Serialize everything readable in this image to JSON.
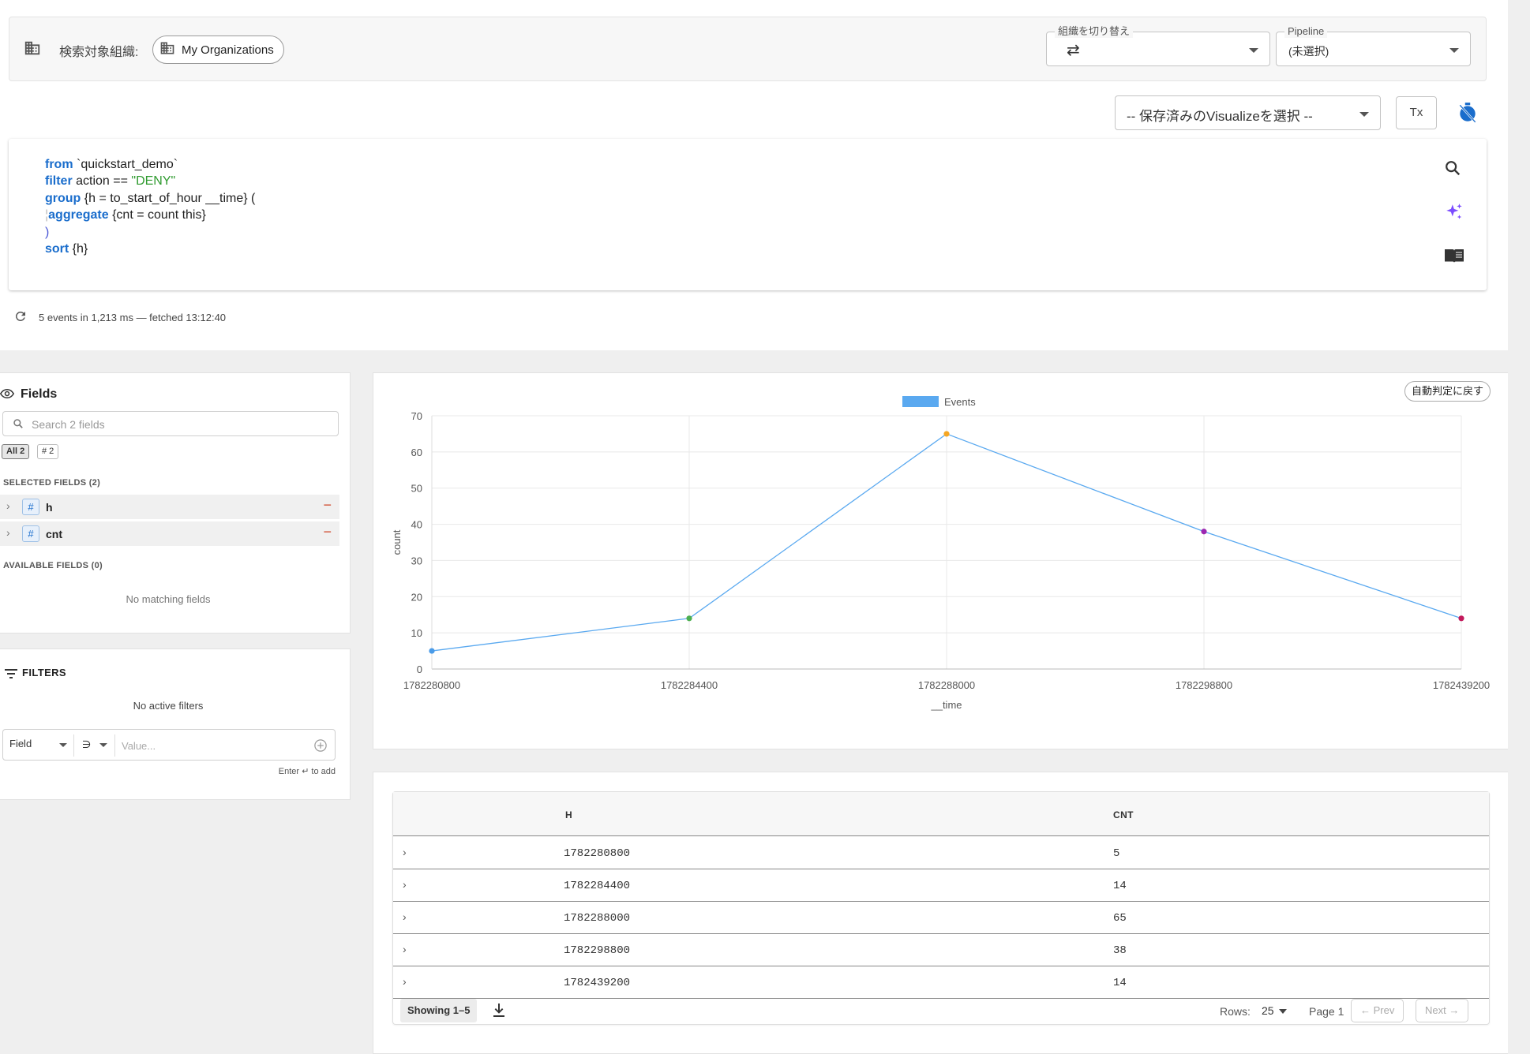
{
  "org_bar": {
    "search_org_label": "検索対象組織:",
    "org_chip": "My Organizations",
    "switch_org": {
      "label": "組織を切り替え"
    },
    "pipeline": {
      "label": "Pipeline",
      "value": "(未選択)"
    }
  },
  "toolbar": {
    "saved_visualize": "-- 保存済みのVisualizeを選択 --",
    "clear_format": "Tx"
  },
  "query": {
    "lines": [
      {
        "kw": "from",
        "rest": " `quickstart_demo`"
      },
      {
        "kw": "filter",
        "rest": " action == ",
        "str": "\"DENY\""
      },
      {
        "kw": "group",
        "rest": " {h = to_start_of_hour __time} ("
      },
      {
        "kw": "aggregate",
        "rest": " {cnt = count this}",
        "indent": true
      },
      {
        "kw": "",
        "rest": ")"
      },
      {
        "kw": "sort",
        "rest": " {h}"
      }
    ]
  },
  "status": {
    "text": "5 events in 1,213 ms — fetched 13:12:40"
  },
  "fields": {
    "title": "Fields",
    "search_placeholder": "Search 2 fields",
    "tabs": [
      "All 2",
      "# 2"
    ],
    "selected_label": "SELECTED FIELDS (2)",
    "selected": [
      {
        "type": "#",
        "name": "h"
      },
      {
        "type": "#",
        "name": "cnt"
      }
    ],
    "available_label": "AVAILABLE FIELDS (0)",
    "no_match": "No matching fields"
  },
  "filters": {
    "title": "FILTERS",
    "no_active": "No active filters",
    "field_select": "Field",
    "operator": "∋",
    "value_placeholder": "Value...",
    "hint": "Enter ↵ to add"
  },
  "chart": {
    "reset_button": "自動判定に戻す"
  },
  "chart_data": {
    "type": "line",
    "x": [
      1782280800,
      1782284400,
      1782288000,
      1782298800,
      1782439200
    ],
    "series": [
      {
        "name": "Events",
        "values": [
          5,
          14,
          65,
          38,
          14
        ]
      }
    ],
    "xlabel": "__time",
    "ylabel": "count",
    "ylim": [
      0,
      70
    ],
    "yticks": [
      0,
      10,
      20,
      30,
      40,
      50,
      60,
      70
    ],
    "legend": "top-center",
    "grid": true,
    "colors": {
      "line": "#5aa9f0",
      "legend": "#5aa9f0",
      "points": [
        "#4a9be8",
        "#4caf50",
        "#f5a623",
        "#9c27b0",
        "#c2185b"
      ]
    }
  },
  "table": {
    "columns": [
      "H",
      "CNT"
    ],
    "rows": [
      [
        "1782280800",
        "5"
      ],
      [
        "1782284400",
        "14"
      ],
      [
        "1782288000",
        "65"
      ],
      [
        "1782298800",
        "38"
      ],
      [
        "1782439200",
        "14"
      ]
    ],
    "showing": "Showing 1–5",
    "rows_label": "Rows:",
    "rows_per_page": "25",
    "page": "Page 1",
    "prev": "← Prev",
    "next": "Next →"
  }
}
